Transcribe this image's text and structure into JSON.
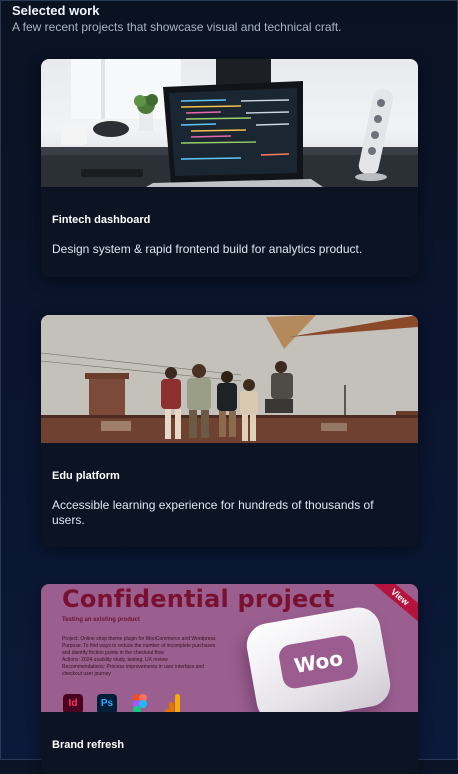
{
  "section": {
    "title": "Selected work",
    "subtitle": "A few recent projects that showcase visual and technical craft."
  },
  "projects": [
    {
      "title": "Fintech dashboard",
      "description": "Design system & rapid frontend build for analytics product."
    },
    {
      "title": "Edu platform",
      "description": "Accessible learning experience for hundreds of thousands of users."
    },
    {
      "title": "Brand refresh",
      "description": ""
    }
  ],
  "woo_image": {
    "heading": "Confidential project",
    "subheading": "Testing an existing product",
    "ribbon": "View",
    "logo_text": "Woo",
    "lines": [
      "Project: Online shop theme plugin for WooCommerce and Wordpress",
      "Purpose: To find ways to reduce the number of incomplete purchases",
      "and identify friction points in the checkout flow",
      "Actions: 2024 usability study, testing, UX review",
      "Recommendations: Process improvements in user interface and",
      "checkout user journey"
    ],
    "apps": [
      "Id",
      "Ps"
    ]
  },
  "colors": {
    "background": "#0b1426",
    "card": "#0c1424",
    "woo_purple": "#9a5f8f",
    "woo_title": "#7a1030"
  }
}
